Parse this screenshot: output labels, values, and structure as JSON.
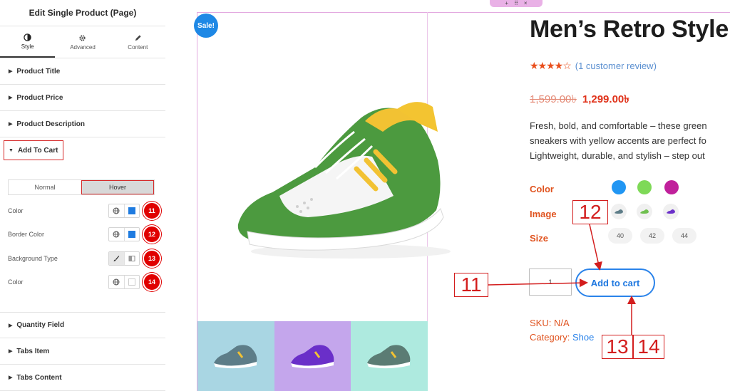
{
  "sidebar": {
    "header_title": "Edit Single Product (Page)",
    "tabs": [
      {
        "label": "Style",
        "icon": "contrast-icon",
        "active": true
      },
      {
        "label": "Advanced",
        "icon": "gear-icon",
        "active": false
      },
      {
        "label": "Content",
        "icon": "pencil-icon",
        "active": false
      }
    ],
    "sections_top": [
      "Product Title",
      "Product Price",
      "Product Description"
    ],
    "open_section": "Add To Cart",
    "state_toggle": {
      "normal": "Normal",
      "hover": "Hover",
      "selected": "Hover"
    },
    "controls": [
      {
        "label": "Color",
        "badge": "11",
        "swatch": "#1e7be0"
      },
      {
        "label": "Border Color",
        "badge": "12",
        "swatch": "#1e7be0"
      },
      {
        "label": "Background Type",
        "badge": "13"
      },
      {
        "label": "Color",
        "badge": "14",
        "swatch": "#ffffff"
      }
    ],
    "sections_bottom": [
      "Quantity Field",
      "Tabs Item",
      "Tabs Content"
    ]
  },
  "product": {
    "sale_badge": "Sale!",
    "title": "Men’s Retro Style",
    "rating_stars": "★★★★☆",
    "review_text": "(1 customer review)",
    "old_price": "1,599.00৳",
    "new_price": "1,299.00৳",
    "description_lines": [
      "Fresh, bold, and comfortable – these green",
      "sneakers with yellow accents are perfect fo",
      "Lightweight, durable, and stylish – step out"
    ],
    "color_label": "Color",
    "colors": [
      "#2196f3",
      "#7ed957",
      "#c0209b"
    ],
    "image_label": "Image",
    "size_label": "Size",
    "sizes": [
      "40",
      "42",
      "44"
    ],
    "quantity": "1",
    "add_to_cart": "Add to cart",
    "sku_label": "SKU: N/A",
    "category_label": "Category:",
    "category_value": "Shoe",
    "thumb_bgs": [
      "#a9d6e3",
      "#c4a6ec",
      "#aeeadf"
    ]
  },
  "annotations": {
    "callout_11": "11",
    "callout_12": "12",
    "callout_13": "13",
    "callout_14": "14"
  },
  "colors": {
    "accent_blue": "#2a83ea",
    "annotation_red": "#d31d1d",
    "sale_blue": "#1e88e5",
    "price_red": "#e0321a"
  }
}
